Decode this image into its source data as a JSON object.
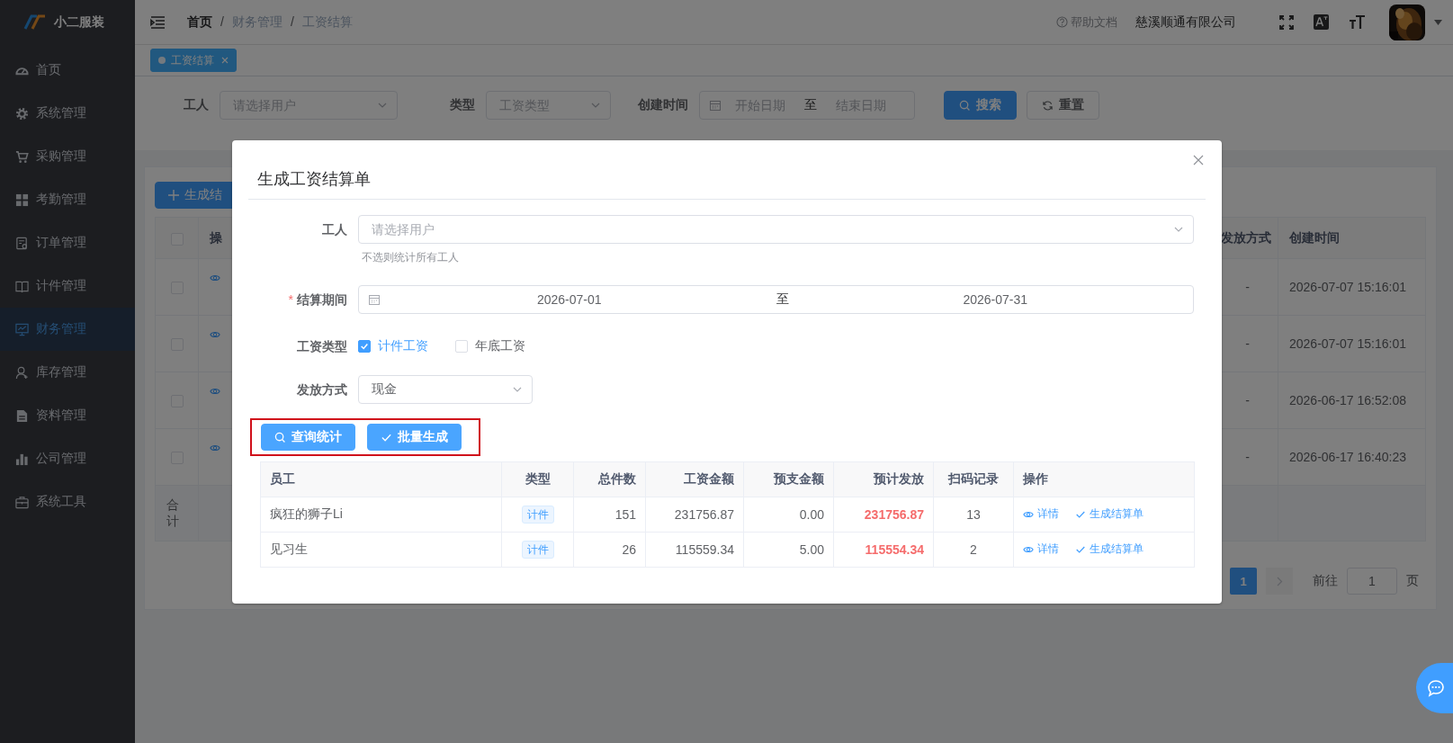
{
  "sidebar": {
    "logo_text": "小二服装",
    "items": [
      {
        "label": "首页",
        "selected": false
      },
      {
        "label": "系统管理",
        "selected": false
      },
      {
        "label": "采购管理",
        "selected": false
      },
      {
        "label": "考勤管理",
        "selected": false
      },
      {
        "label": "订单管理",
        "selected": false
      },
      {
        "label": "计件管理",
        "selected": false
      },
      {
        "label": "财务管理",
        "selected": true
      },
      {
        "label": "库存管理",
        "selected": false
      },
      {
        "label": "资料管理",
        "selected": false
      },
      {
        "label": "公司管理",
        "selected": false
      },
      {
        "label": "系统工具",
        "selected": false
      }
    ]
  },
  "header": {
    "breadcrumb": [
      {
        "kind": "link",
        "label": "首页"
      },
      {
        "kind": "separator",
        "label": "/"
      },
      {
        "kind": "text",
        "label": "财务管理"
      },
      {
        "kind": "separator",
        "label": "/"
      },
      {
        "kind": "text",
        "label": "工资结算"
      }
    ],
    "help": "帮助文档",
    "company": "慈溪顺通有限公司"
  },
  "tabs": [
    {
      "label": "工资结算",
      "selected": true
    }
  ],
  "filters": [
    {
      "kind": "select",
      "label": "工人",
      "placeholder": "请选择用户"
    },
    {
      "kind": "select",
      "label": "类型",
      "placeholder": "工资类型"
    },
    {
      "kind": "daterange",
      "label": "创建时间",
      "start_placeholder": "开始日期",
      "separator": "至",
      "end_placeholder": "结束日期"
    }
  ],
  "filter_buttons": [
    {
      "kind": "primary",
      "label": "搜索"
    },
    {
      "kind": "default",
      "label": "重置"
    }
  ],
  "list": {
    "create_button": "生成结",
    "header_checked": false,
    "columns": [
      "操",
      "发放方式",
      "创建时间"
    ],
    "rows": [
      {
        "checked": false,
        "pay_method": "-",
        "created": "2026-07-07 15:16:01"
      },
      {
        "checked": false,
        "pay_method": "-",
        "created": "2026-07-07 15:16:01"
      },
      {
        "checked": false,
        "pay_method": "-",
        "created": "2026-06-17 16:52:08"
      },
      {
        "checked": false,
        "pay_method": "-",
        "created": "2026-06-17 16:40:23"
      }
    ],
    "footer": "合计"
  },
  "pagination": {
    "pages": [
      {
        "label": "1",
        "selected": true
      }
    ],
    "goto_label": "前往",
    "goto_value": "1",
    "goto_suffix": "页"
  },
  "dialog": {
    "title": "生成工资结算单",
    "fields": [
      {
        "kind": "select",
        "label": "工人",
        "placeholder": "请选择用户",
        "hint": "不选则统计所有工人"
      },
      {
        "kind": "daterange",
        "label": "结算期间",
        "required_mark": "*",
        "start": "2026-07-01",
        "separator": "至",
        "end": "2026-07-31"
      },
      {
        "kind": "checkboxes",
        "label": "工资类型",
        "options": [
          {
            "label": "计件工资",
            "checked": true
          },
          {
            "label": "年底工资",
            "checked": false
          }
        ]
      },
      {
        "kind": "select",
        "label": "发放方式",
        "value": "现金"
      }
    ],
    "buttons_highlighted": true,
    "buttons": [
      {
        "kind": "search",
        "label": "查询统计"
      },
      {
        "kind": "check",
        "label": "批量生成"
      }
    ],
    "table": {
      "columns": [
        "员工",
        "类型",
        "总件数",
        "工资金额",
        "预支金额",
        "预计发放",
        "扫码记录",
        "操作"
      ],
      "rows": [
        {
          "employee": "疯狂的狮子Li",
          "type": "计件",
          "pieces": "151",
          "wage": "231756.87",
          "advance": "0.00",
          "expected": "231756.87",
          "scans": "13",
          "actions": [
            "详情",
            "生成结算单"
          ]
        },
        {
          "employee": "见习生",
          "type": "计件",
          "pieces": "26",
          "wage": "115559.34",
          "advance": "5.00",
          "expected": "115554.34",
          "scans": "2",
          "actions": [
            "详情",
            "生成结算单"
          ]
        }
      ]
    }
  }
}
